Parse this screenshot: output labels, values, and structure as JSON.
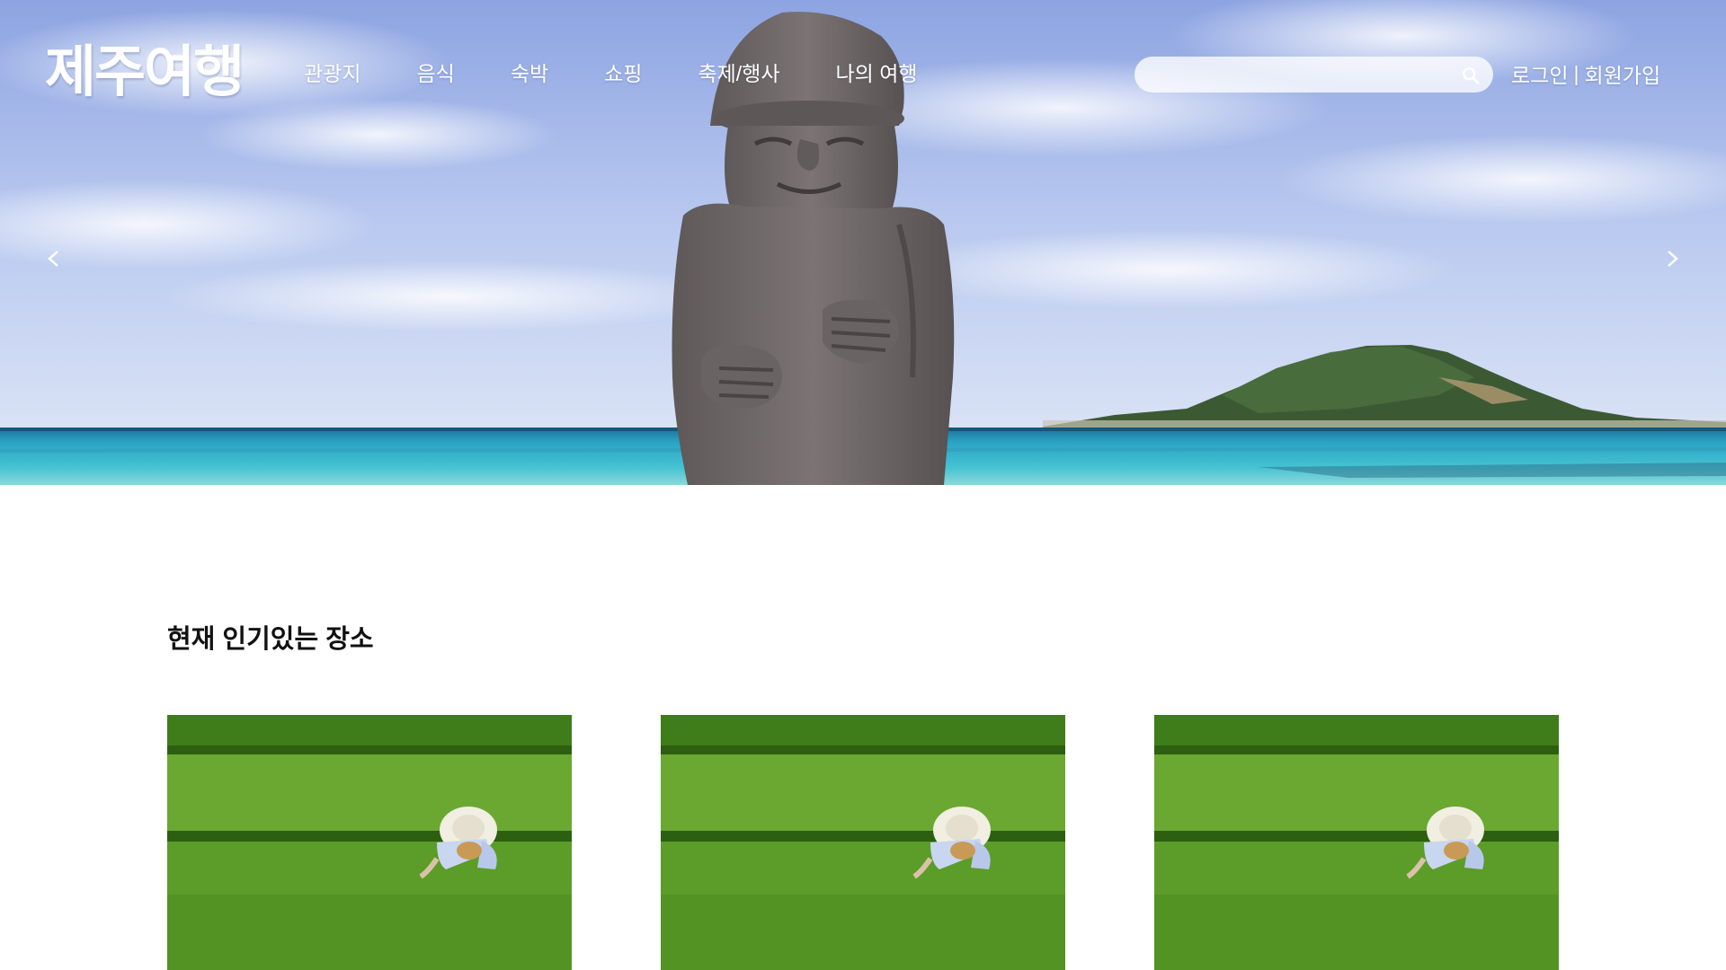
{
  "header": {
    "logo_text": "제주여행",
    "nav_items": [
      "관광지",
      "음식",
      "숙박",
      "쇼핑",
      "축제/행사",
      "나의 여행"
    ],
    "search": {
      "placeholder": "",
      "value": "",
      "icon": "search-icon"
    },
    "auth": {
      "login_label": "로그인",
      "separator": "|",
      "signup_label": "회원가입"
    }
  },
  "hero": {
    "prev_label": "<",
    "next_label": ">"
  },
  "main": {
    "section_title": "현재 인기있는 장소",
    "cards": [
      {
        "image": "tea-field-farmer-image"
      },
      {
        "image": "tea-field-farmer-image"
      },
      {
        "image": "tea-field-farmer-image"
      }
    ]
  },
  "colors": {
    "sky_top": "#8fa6e3",
    "sea": "#3fb9cf",
    "stone": "#6f6a6a",
    "field_green": "#5a9a2a",
    "text_white": "#ffffff",
    "title_text": "#111111"
  }
}
